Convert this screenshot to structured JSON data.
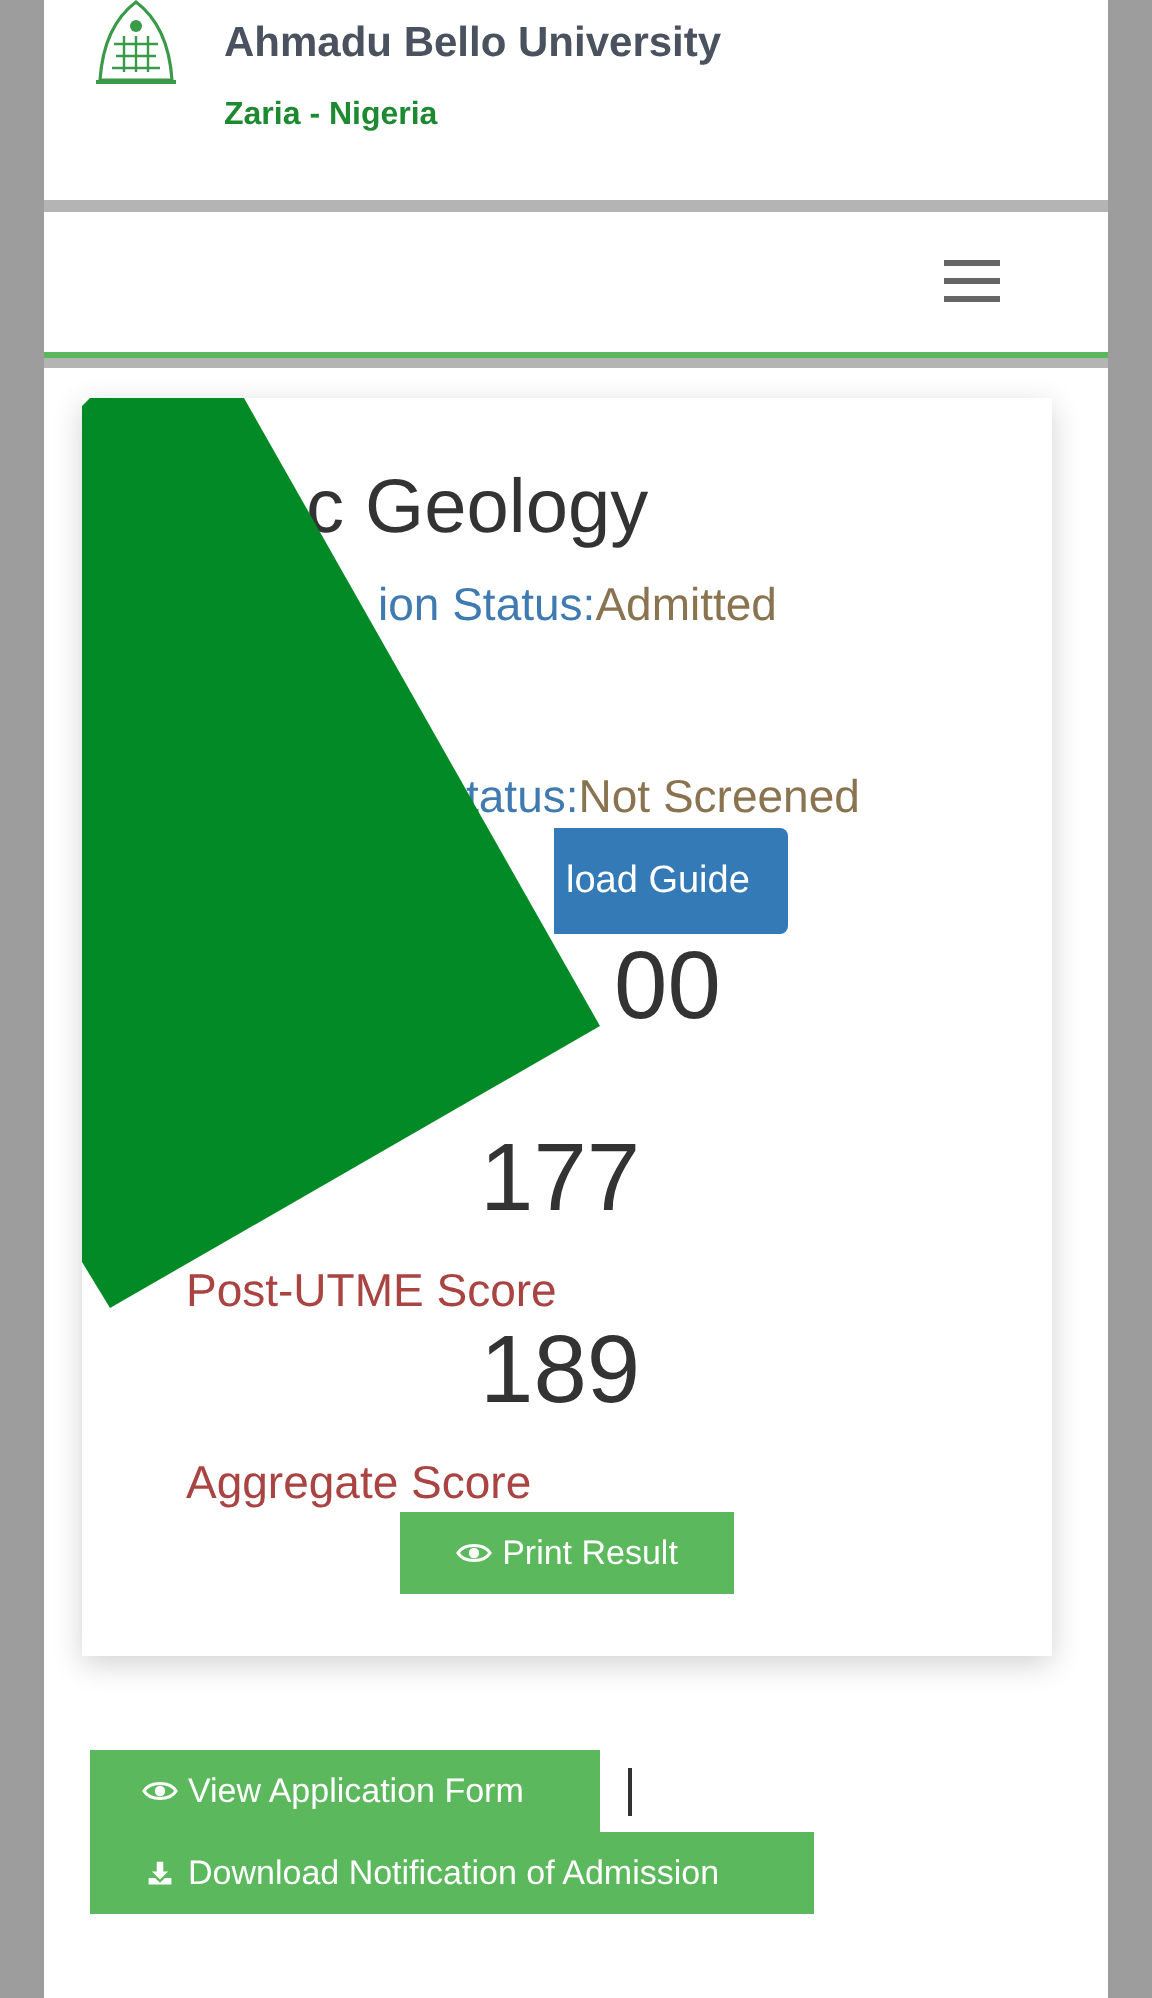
{
  "header": {
    "title": "Ahmadu Bello University",
    "subtitle": "Zaria - Nigeria"
  },
  "card": {
    "programme": "c Geology",
    "admission_status": {
      "label": "ion Status:",
      "value": "Admitted"
    },
    "screening_status": {
      "label": "tatus:",
      "value": "Not Screened"
    },
    "guide_button": "load Guide",
    "scores": [
      {
        "value": "00"
      },
      {
        "value": "177"
      },
      {
        "label": "Post-UTME Score",
        "value": "189"
      },
      {
        "label": "Aggregate Score"
      }
    ],
    "print_button": {
      "label": "Print Result",
      "kind": "eye"
    }
  },
  "actions": [
    {
      "label": "View Application Form",
      "kind": "eye"
    },
    {
      "label": "Download Notification of Admission",
      "kind": "download"
    }
  ]
}
